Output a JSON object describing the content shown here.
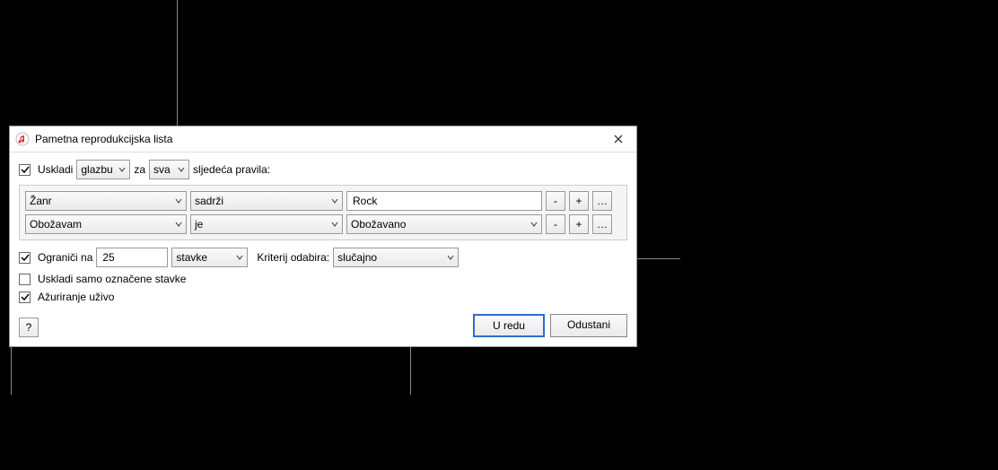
{
  "dialog": {
    "title": "Pametna reprodukcijska lista",
    "match": {
      "checkbox_label": "Uskladi",
      "checked": true,
      "type_select": "glazbu",
      "for_label": "za",
      "scope_select": "sva",
      "suffix_label": "sljedeća pravila:"
    },
    "rules": [
      {
        "field": "Žanr",
        "operator": "sadrži",
        "value": "Rock",
        "value_is_select": false,
        "minus": "-",
        "plus": "+",
        "more": "…"
      },
      {
        "field": "Obožavam",
        "operator": "je",
        "value": "Obožavano",
        "value_is_select": true,
        "minus": "-",
        "plus": "+",
        "more": "…"
      }
    ],
    "limit": {
      "checked": true,
      "label": "Ograniči na",
      "value": "25",
      "unit_select": "stavke",
      "criteria_label": "Kriterij odabira:",
      "criteria_select": "slučajno"
    },
    "only_checked": {
      "checked": false,
      "label": "Uskladi samo označene stavke"
    },
    "live_update": {
      "checked": true,
      "label": "Ažuriranje uživo"
    },
    "help": "?",
    "buttons": {
      "ok": "U redu",
      "cancel": "Odustani"
    }
  }
}
